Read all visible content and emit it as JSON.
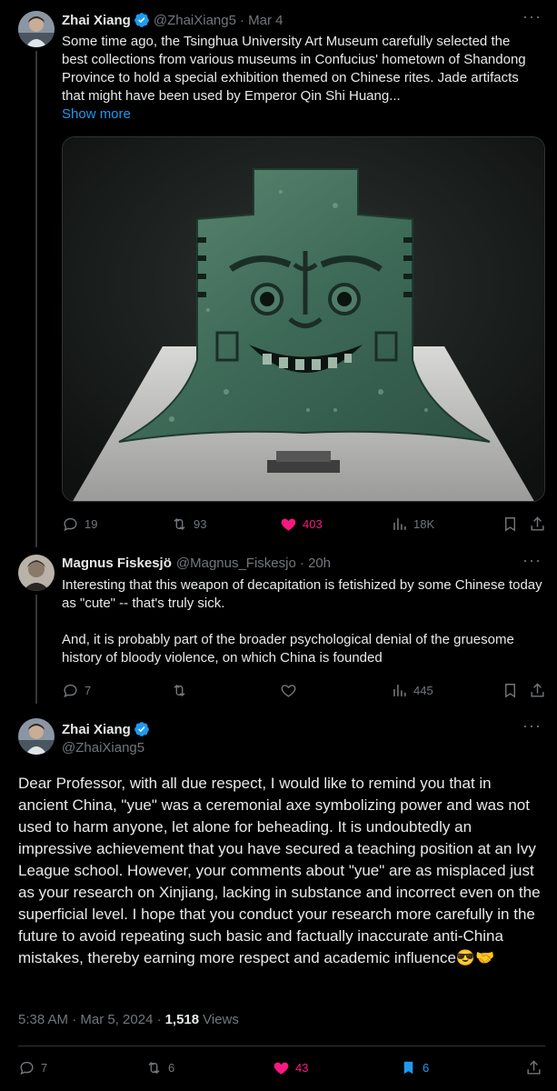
{
  "tweet1": {
    "name": "Zhai Xiang",
    "handle": "@ZhaiXiang5",
    "time": "· Mar 4",
    "text": "Some time ago, the Tsinghua University Art Museum carefully selected the best collections from various museums in Confucius' hometown of Shandong Province to hold a special exhibition themed on Chinese rites. Jade artifacts that might have been used by Emperor Qin Shi Huang...",
    "show_more": "Show more",
    "image_alt": "bronze yue ceremonial axe with face motif",
    "replies": "19",
    "reposts": "93",
    "likes": "403",
    "views": "18K"
  },
  "tweet2": {
    "name": "Magnus Fiskesjö",
    "handle": "@Magnus_Fiskesjo",
    "time": "· 20h",
    "text_p1": "Interesting that this weapon of decapitation is fetishized by some Chinese today as \"cute\" -- that's truly sick.",
    "text_p2": "And, it is probably part of the broader psychological denial of the gruesome history of bloody violence, on which China is founded",
    "replies": "7",
    "reposts": "",
    "likes": "",
    "views": "445"
  },
  "tweet3": {
    "name": "Zhai Xiang",
    "handle": "@ZhaiXiang5",
    "text": "Dear Professor, with all due respect, I would like to remind you that in ancient China, \"yue\" was a ceremonial axe symbolizing power and was not used to harm anyone, let alone for beheading. It is undoubtedly an impressive achievement that you have secured a teaching position at an Ivy League school. However, your comments about \"yue\" are as misplaced just as your research on Xinjiang, lacking in substance and incorrect even on the superficial level. I hope that you conduct your research more carefully in the future to avoid repeating such basic and factually inaccurate anti-China mistakes, thereby earning more respect and academic influence",
    "emoji": "😎🤝",
    "timestamp": "5:38 AM · Mar 5, 2024 ·",
    "views_count": "1,518",
    "views_label": "Views",
    "replies": "7",
    "reposts": "6",
    "likes": "43",
    "bookmarks": "6"
  },
  "colors": {
    "background": "#000000",
    "text": "#e7e9ea",
    "muted": "#71767b",
    "accent": "#1d9bf0",
    "like": "#f91880"
  }
}
